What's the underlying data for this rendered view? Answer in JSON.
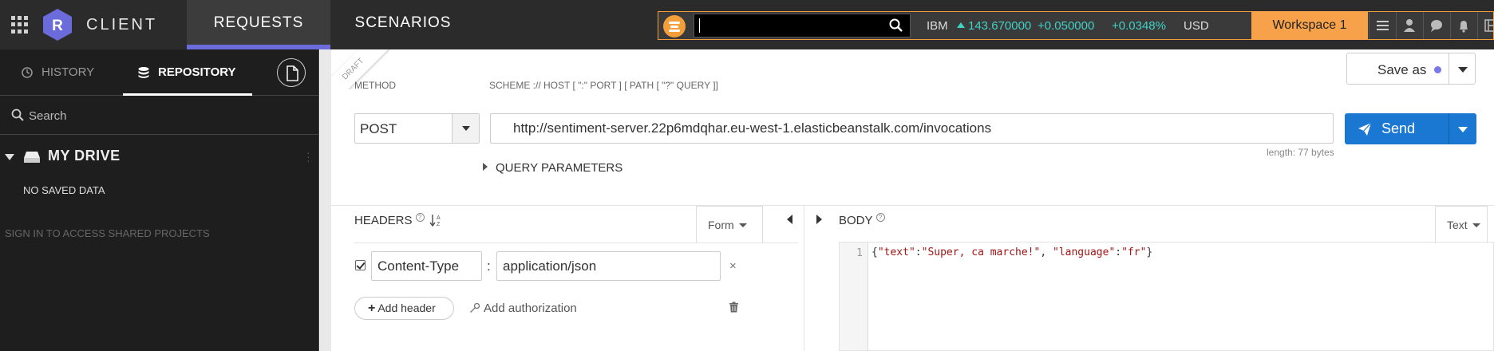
{
  "app": {
    "brand": "CLIENT",
    "logo_letter": "R",
    "nav_tabs": [
      {
        "label": "REQUESTS",
        "active": true
      },
      {
        "label": "SCENARIOS",
        "active": false
      }
    ]
  },
  "ticker": {
    "search_value": "",
    "symbol": "IBM",
    "price": "143.670000",
    "change": "+0.050000",
    "change_pct": "+0.0348%",
    "currency": "USD",
    "workspace": "Workspace 1",
    "icons": [
      "menu-icon",
      "user-icon",
      "chat-icon",
      "bell-icon",
      "layout-icon"
    ]
  },
  "sidebar": {
    "tabs": [
      {
        "label": "HISTORY",
        "active": false
      },
      {
        "label": "REPOSITORY",
        "active": true
      }
    ],
    "search_placeholder": "Search",
    "drive_label": "MY DRIVE",
    "no_saved": "NO SAVED DATA",
    "signin": "SIGN IN TO ACCESS SHARED PROJECTS"
  },
  "request": {
    "draft_label": "DRAFT",
    "save_as": "Save as",
    "method_label": "METHOD",
    "method": "POST",
    "url_label": "SCHEME :// HOST [ \":\" PORT ] [ PATH [ \"?\" QUERY ]]",
    "url": "http://sentiment-server.22p6mdqhar.eu-west-1.elasticbeanstalk.com/invocations",
    "length": "length: 77 bytes",
    "send": "Send",
    "query_params": "QUERY PARAMETERS"
  },
  "headers": {
    "title": "HEADERS",
    "mode": "Form",
    "items": [
      {
        "enabled": true,
        "key": "Content-Type",
        "value": "application/json"
      }
    ],
    "add_header": "Add header",
    "add_auth": "Add authorization"
  },
  "body": {
    "title": "BODY",
    "mode": "Text",
    "line_number": "1",
    "code_text": "{\"text\":\"Super, ca marche!\", \"language\":\"fr\"}"
  },
  "colors": {
    "accent": "#6b6bdc",
    "send_blue": "#1a78d2",
    "workspace_orange": "#f7a24a",
    "ticker_up": "#3fd2c7"
  }
}
